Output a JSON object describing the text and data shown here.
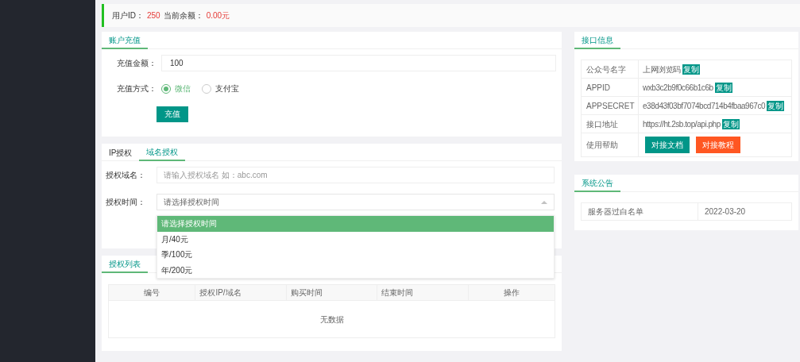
{
  "notice": {
    "user_id_label": "用户ID：",
    "user_id": "250",
    "balance_label": "当前余额：",
    "balance": "0.00元"
  },
  "recharge": {
    "tabs": [
      {
        "label": "账户充值",
        "selected": true
      }
    ],
    "amount_label": "充值金额：",
    "amount_value": "100",
    "method_label": "充值方式：",
    "methods": [
      {
        "label": "微信",
        "selected": true
      },
      {
        "label": "支付宝",
        "selected": false
      }
    ],
    "submit": "充值"
  },
  "authorize": {
    "tabs": [
      {
        "label": "IP授权",
        "selected": false
      },
      {
        "label": "域名授权",
        "selected": true
      }
    ],
    "domain_label": "授权域名：",
    "domain_placeholder": "请输入授权域名 如：abc.com",
    "time_label": "授权时间：",
    "time_placeholder": "请选择授权时间",
    "dropdown": {
      "expanded": true,
      "options": [
        {
          "label": "请选择授权时间",
          "selected": true
        },
        {
          "label": "月/40元",
          "selected": false
        },
        {
          "label": "季/100元",
          "selected": false
        },
        {
          "label": "年/200元",
          "selected": false
        }
      ]
    }
  },
  "auth_list": {
    "tabs": [
      {
        "label": "授权列表",
        "selected": true
      }
    ],
    "table": {
      "columns": [
        "编号",
        "授权IP/域名",
        "购买时间",
        "结束时间",
        "操作"
      ],
      "empty_text": "无数据"
    }
  },
  "api_info": {
    "tabs": [
      {
        "label": "接口信息",
        "selected": true
      }
    ],
    "rows": [
      {
        "label": "公众号名字",
        "value": "上网浏览码",
        "copy": "复制"
      },
      {
        "label": "APPID",
        "value": "wxb3c2b9f0c66b1c6b",
        "copy": "复制"
      },
      {
        "label": "APPSECRET",
        "value": "e38d43f03bf7074bcd714b4fbaa967c0",
        "copy": "复制"
      },
      {
        "label": "接口地址",
        "value": "https://ht.2sb.top/api.php",
        "copy": "复制"
      }
    ],
    "help_label": "使用帮助",
    "help_buttons": [
      {
        "label": "对接文档",
        "kind": "primary"
      },
      {
        "label": "对接教程",
        "kind": "warning"
      }
    ]
  },
  "announcements": {
    "tabs": [
      {
        "label": "系统公告",
        "selected": true
      }
    ],
    "rows": [
      {
        "title": "服务器过白名单",
        "date": "2022-03-20"
      }
    ]
  }
}
